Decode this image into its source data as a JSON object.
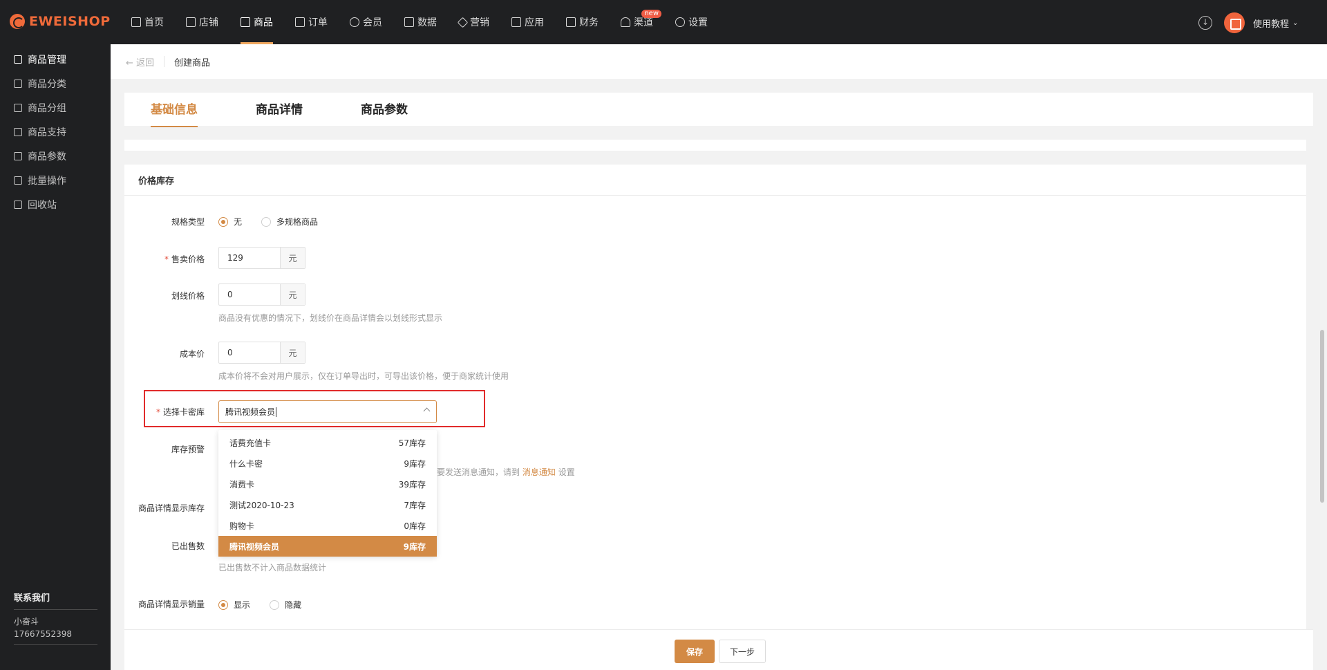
{
  "app": {
    "logo_text": "EWEISHOP"
  },
  "nav": [
    {
      "label": "首页",
      "icon": "home-icon"
    },
    {
      "label": "店铺",
      "icon": "store-icon"
    },
    {
      "label": "商品",
      "icon": "goods-icon",
      "active": true
    },
    {
      "label": "订单",
      "icon": "order-icon"
    },
    {
      "label": "会员",
      "icon": "member-icon"
    },
    {
      "label": "数据",
      "icon": "chart-icon"
    },
    {
      "label": "营销",
      "icon": "tag-icon"
    },
    {
      "label": "应用",
      "icon": "app-icon"
    },
    {
      "label": "财务",
      "icon": "finance-icon"
    },
    {
      "label": "渠道",
      "icon": "channel-icon",
      "badge": "new"
    },
    {
      "label": "设置",
      "icon": "gear-icon"
    }
  ],
  "header_right": {
    "tutorial_label": "使用教程"
  },
  "sidebar": {
    "items": [
      {
        "label": "商品管理",
        "active": true
      },
      {
        "label": "商品分类"
      },
      {
        "label": "商品分组"
      },
      {
        "label": "商品支持"
      },
      {
        "label": "商品参数"
      },
      {
        "label": "批量操作"
      },
      {
        "label": "回收站"
      }
    ],
    "contact": {
      "title": "联系我们",
      "name": "小奋斗",
      "phone": "17667552398"
    }
  },
  "breadcrumb": {
    "back_label": "← 返回",
    "title": "创建商品"
  },
  "tabs": [
    {
      "label": "基础信息",
      "active": true
    },
    {
      "label": "商品详情"
    },
    {
      "label": "商品参数"
    }
  ],
  "section": {
    "title": "价格库存"
  },
  "form": {
    "spec_type": {
      "label": "规格类型",
      "options": [
        "无",
        "多规格商品"
      ],
      "selected": "无"
    },
    "sale_price": {
      "label": "售卖价格",
      "value": "129",
      "unit": "元"
    },
    "strike_price": {
      "label": "划线价格",
      "value": "0",
      "unit": "元",
      "hint": "商品没有优惠的情况下，划线价在商品详情会以划线形式显示"
    },
    "cost_price": {
      "label": "成本价",
      "value": "0",
      "unit": "元",
      "hint": "成本价将不会对用户展示，仅在订单导出时，可导出该价格，便于商家统计使用"
    },
    "card_library": {
      "label": "选择卡密库",
      "value": "腾讯视频会员"
    },
    "stock_warning": {
      "label": "库存预警",
      "hint_tail": "要发送消息通知，请到",
      "hint_link": "消息通知",
      "hint_end": "设置"
    },
    "show_stock": {
      "label": "商品详情显示库存"
    },
    "sold_count": {
      "label": "已出售数",
      "hint": "已出售数不计入商品数据统计"
    },
    "show_sales": {
      "label": "商品详情显示销量",
      "options": [
        "显示",
        "隐藏"
      ],
      "selected": "显示"
    }
  },
  "dropdown": {
    "options": [
      {
        "name": "话费充值卡",
        "stock": "57库存"
      },
      {
        "name": "什么卡密",
        "stock": "9库存"
      },
      {
        "name": "消费卡",
        "stock": "39库存"
      },
      {
        "name": "测试2020-10-23",
        "stock": "7库存"
      },
      {
        "name": "购物卡",
        "stock": "0库存"
      },
      {
        "name": "腾讯视频会员",
        "stock": "9库存",
        "selected": true
      }
    ]
  },
  "footer": {
    "save_label": "保存",
    "next_label": "下一步"
  },
  "colors": {
    "accent": "#d38a45",
    "brand": "#ef6a3a",
    "topbar": "#1f2022",
    "highlight": "#e12b2b"
  }
}
